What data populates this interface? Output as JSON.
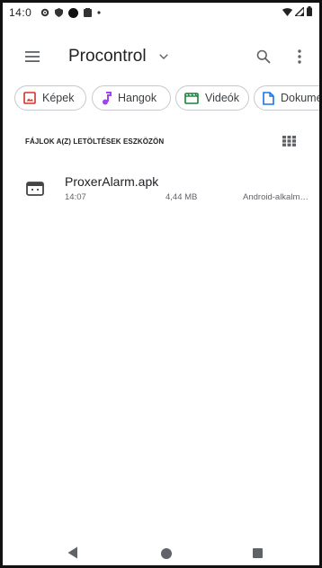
{
  "status_bar": {
    "time": "14:0",
    "icons": [
      "settings-icon",
      "shield-icon",
      "circle-icon",
      "clipboard-icon",
      "dot-icon"
    ],
    "right_icons": [
      "wifi-icon",
      "signal-icon",
      "battery-icon"
    ]
  },
  "app_bar": {
    "title": "Procontrol",
    "menu_icon": "hamburger-menu-icon",
    "search_icon": "search-icon",
    "more_icon": "more-vert-icon"
  },
  "chips": [
    {
      "label": "Képek",
      "icon": "image-icon",
      "color": "#d93025"
    },
    {
      "label": "Hangok",
      "icon": "music-note-icon",
      "color": "#a142f4"
    },
    {
      "label": "Videók",
      "icon": "movie-icon",
      "color": "#188038"
    },
    {
      "label": "Dokumen",
      "icon": "document-icon",
      "color": "#1a73e8"
    }
  ],
  "section": {
    "title": "FÁJLOK A(Z) LETÖLTÉSEK ESZKÖZÖN",
    "view_icon": "grid-view-icon"
  },
  "files": [
    {
      "name": "ProxerAlarm.apk",
      "time": "14:07",
      "size": "4,44 MB",
      "type": "Android-alkalm…",
      "icon": "android-apk-icon"
    }
  ],
  "nav": {
    "back": "back-icon",
    "home": "home-icon",
    "recents": "recents-icon"
  }
}
